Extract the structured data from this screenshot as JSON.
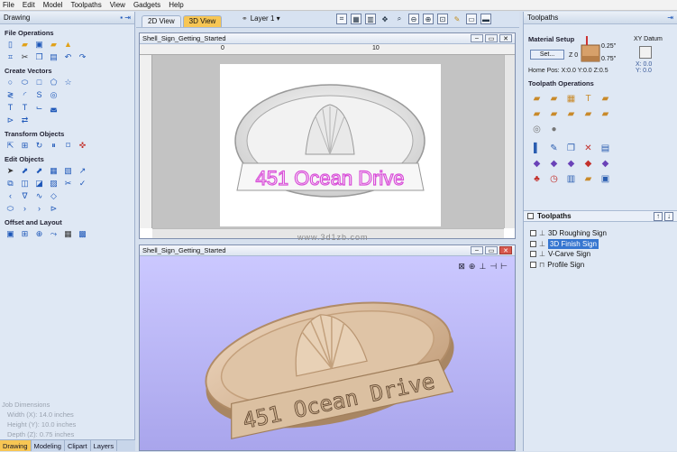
{
  "menubar": [
    "File",
    "Edit",
    "Model",
    "Toolpaths",
    "View",
    "Gadgets",
    "Help"
  ],
  "left_panel": {
    "title": "Drawing",
    "pin": "▪ ⇥",
    "sections": {
      "file_ops": "File Operations",
      "create_vectors": "Create Vectors",
      "transform": "Transform Objects",
      "edit": "Edit Objects",
      "offset": "Offset and Layout"
    },
    "job_dims": {
      "title": "Job Dimensions",
      "width": "Width  (X): 14.0 inches",
      "height": "Height (Y): 10.0 inches",
      "depth": "Depth  (Z): 0.75 inches"
    },
    "tabs": [
      "Drawing",
      "Modeling",
      "Clipart",
      "Layers"
    ]
  },
  "view_tabs": [
    "2D View",
    "3D View"
  ],
  "layer_label": "Layer 1 ▾",
  "window_2d": {
    "title": "Shell_Sign_Getting_Started",
    "ruler_marks": [
      "0",
      "10"
    ],
    "sign_text": "451 Ocean Drive"
  },
  "window_3d": {
    "title": "Shell_Sign_Getting_Started",
    "sign_text": "451 Ocean Drive"
  },
  "right_panel": {
    "title": "Toolpaths",
    "material_setup": "Material Setup",
    "set_button": "Set...",
    "z0_label": "Z 0",
    "dim1": "0.25\"",
    "dim2": "0.75\"",
    "home_pos": "Home Pos:  X:0.0 Y:0.0 Z:0.5",
    "xy_datum": "XY Datum",
    "xy_vals": "X: 0.0\nY: 0.0",
    "toolpath_ops": "Toolpath Operations",
    "toolpaths_header": "Toolpaths",
    "toolpaths": [
      {
        "name": "3D Roughing Sign",
        "selected": false
      },
      {
        "name": "3D Finish Sign",
        "selected": true
      },
      {
        "name": "V-Carve Sign",
        "selected": false
      },
      {
        "name": "Profile Sign",
        "selected": false
      }
    ]
  },
  "watermark": "www.3d1zb.com",
  "colors": {
    "accent_tab": "#f7c654",
    "sign_text_2d": "#d84fd8",
    "wood": "#d8b99a",
    "bg3d": "#b9b6f6"
  }
}
